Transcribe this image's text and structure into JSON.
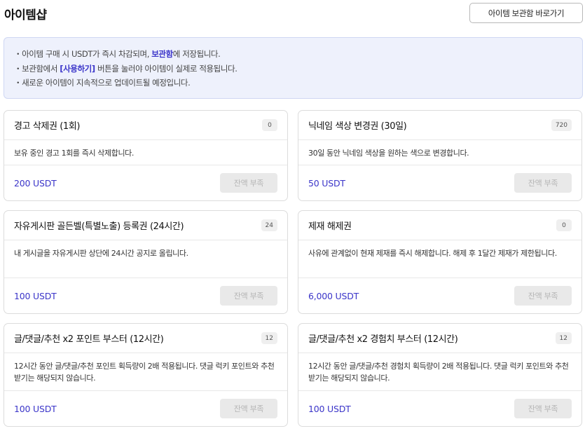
{
  "header": {
    "title": "아이템샵",
    "vault_button": "아이템 보관함 바로가기"
  },
  "notice": {
    "line1_a": "・아이템 구매 시 USDT가 즉시 차감되며, ",
    "line1_hl": "보관함",
    "line1_b": "에 저장됩니다.",
    "line2_a": "・보관함에서 ",
    "line2_hl": "[사용하기]",
    "line2_b": " 버튼을 눌러야 아이템이 실제로 적용됩니다.",
    "line3": "・새로운 아이템이 지속적으로 업데이트될 예정입니다."
  },
  "items": [
    {
      "title": "경고 삭제권 (1회)",
      "count": "0",
      "description": "보유 중인 경고 1회를 즉시 삭제합니다.",
      "price": "200 USDT",
      "button": "잔액 부족"
    },
    {
      "title": "닉네임 색상 변경권 (30일)",
      "count": "720",
      "description": "30일 동안 닉네임 색상을 원하는 색으로 변경합니다.",
      "price": "50 USDT",
      "button": "잔액 부족"
    },
    {
      "title": "자유게시판 골든벨(특별노출) 등록권 (24시간)",
      "count": "24",
      "description": "내 게시글을 자유게시판 상단에 24시간 공지로 올립니다.",
      "price": "100 USDT",
      "button": "잔액 부족"
    },
    {
      "title": "제재 해제권",
      "count": "0",
      "description": "사유에 관계없이 현재 제재를 즉시 해제합니다. 해제 후 1달간 제재가 제한됩니다.",
      "price": "6,000 USDT",
      "button": "잔액 부족"
    },
    {
      "title": "글/댓글/추천 x2 포인트 부스터 (12시간)",
      "count": "12",
      "description": "12시간 동안 글/댓글/추천 포인트 획득량이 2배 적용됩니다. 댓글 럭키 포인트와 추천받기는 해당되지 않습니다.",
      "price": "100 USDT",
      "button": "잔액 부족"
    },
    {
      "title": "글/댓글/추천 x2 경험치 부스터 (12시간)",
      "count": "12",
      "description": "12시간 동안 글/댓글/추천 경험치 획득량이 2배 적용됩니다. 댓글 럭키 포인트와 추천받기는 해당되지 않습니다.",
      "price": "100 USDT",
      "button": "잔액 부족"
    }
  ]
}
